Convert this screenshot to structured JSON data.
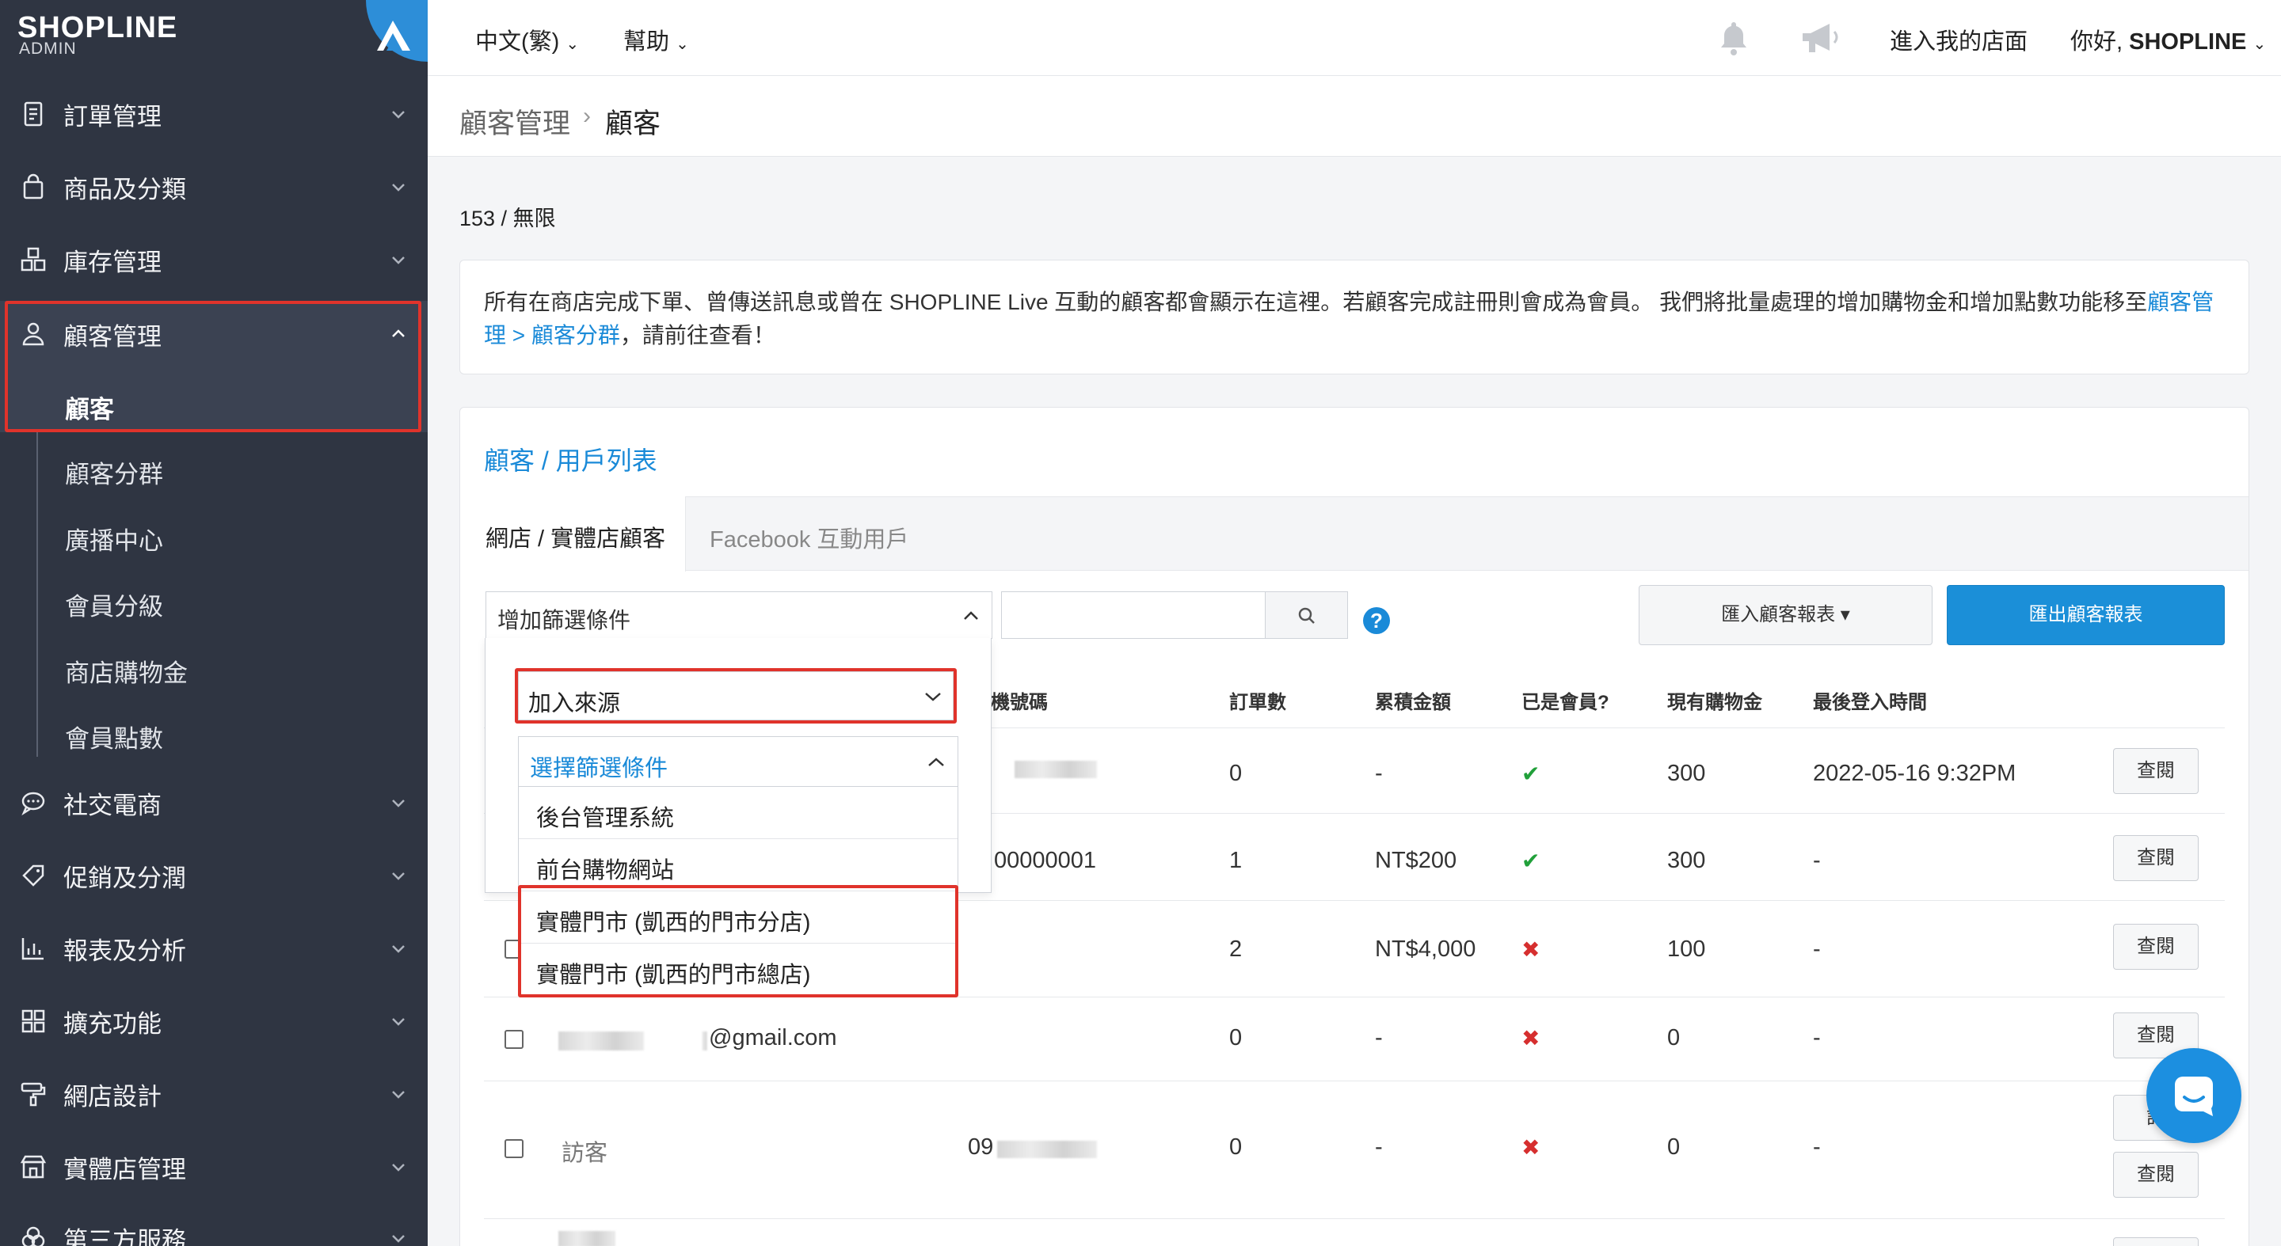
{
  "brand": {
    "name": "SHOPLINE",
    "sub": "ADMIN"
  },
  "sidebar": {
    "items": [
      {
        "label": "訂單管理",
        "icon": "receipt-icon"
      },
      {
        "label": "商品及分類",
        "icon": "shopping-bag-icon"
      },
      {
        "label": "庫存管理",
        "icon": "inventory-icon"
      },
      {
        "label": "顧客管理",
        "icon": "user-icon"
      },
      {
        "label": "社交電商",
        "icon": "chat-bubble-icon"
      },
      {
        "label": "促銷及分潤",
        "icon": "tag-icon"
      },
      {
        "label": "報表及分析",
        "icon": "chart-icon"
      },
      {
        "label": "擴充功能",
        "icon": "apps-icon"
      },
      {
        "label": "網店設計",
        "icon": "paint-roller-icon"
      },
      {
        "label": "實體店管理",
        "icon": "store-icon"
      },
      {
        "label": "第三方服務",
        "icon": "integration-icon"
      }
    ],
    "subitems": [
      "顧客",
      "顧客分群",
      "廣播中心",
      "會員分級",
      "商店購物金",
      "會員點數"
    ]
  },
  "topbar": {
    "language": "中文(繁)",
    "help": "幫助",
    "enter_store": "進入我的店面",
    "greeting": "你好,",
    "user": "SHOPLINE"
  },
  "breadcrumb": {
    "parent": "顧客管理",
    "sep": "›",
    "current": "顧客"
  },
  "count_text": "153 / 無限",
  "notice": {
    "text": "所有在商店完成下單、曾傳送訊息或曾在 SHOPLINE Live 互動的顧客都會顯示在這裡。若顧客完成註冊則會成為會員。 我們將批量處理的增加購物金和增加點數功能移至",
    "link": "顧客管理 > 顧客分群",
    "tail": "，請前往查看！"
  },
  "panel": {
    "title": "顧客 / 用戶列表",
    "tabs": [
      "網店 / 實體店顧客",
      "Facebook 互動用戶"
    ],
    "filter_label": "增加篩選條件",
    "import_label": "匯入顧客報表 ▾",
    "export_label": "匯出顧客報表",
    "help_mark": "?"
  },
  "table": {
    "headers": [
      "機號碼",
      "訂單數",
      "累積金額",
      "已是會員?",
      "現有購物金",
      "最後登入時間"
    ],
    "rows": [
      {
        "name": "",
        "email": "",
        "phone": "",
        "orders": "0",
        "total": "-",
        "member": true,
        "credit": "300",
        "last_login": "2022-05-16 9:32PM",
        "action": "查閱"
      },
      {
        "name": "",
        "email": "",
        "phone": "00000001",
        "orders": "1",
        "total": "NT$200",
        "member": true,
        "credit": "300",
        "last_login": "-",
        "action": "查閱"
      },
      {
        "name": "",
        "email": "",
        "phone": "",
        "orders": "2",
        "total": "NT$4,000",
        "member": false,
        "credit": "100",
        "last_login": "-",
        "action": "查閱"
      },
      {
        "name": "",
        "email": "@gmail.com",
        "phone": "",
        "orders": "0",
        "total": "-",
        "member": false,
        "credit": "0",
        "last_login": "-",
        "action": "查閱"
      },
      {
        "name": "訪客",
        "email": "",
        "phone": "09",
        "orders": "0",
        "total": "-",
        "member": false,
        "credit": "0",
        "last_login": "-",
        "action": "查閱"
      }
    ],
    "extra_action": "訂"
  },
  "dropdown": {
    "selected": "加入來源",
    "placeholder": "選擇篩選條件",
    "options": [
      "後台管理系統",
      "前台購物網站",
      "實體門市 (凱西的門市分店)",
      "實體門市 (凱西的門市總店)"
    ]
  },
  "colors": {
    "sidebar": "#2f3542",
    "accent": "#1a8ad8",
    "highlight": "#e0332b",
    "ok": "#21a03a",
    "no": "#d62f2f"
  }
}
